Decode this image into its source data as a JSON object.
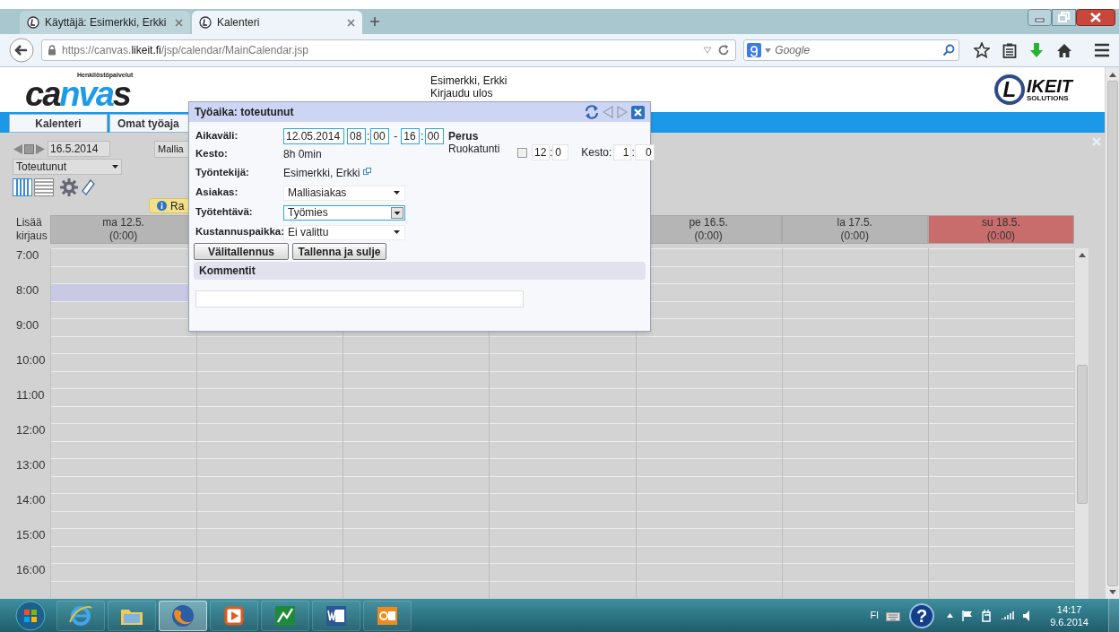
{
  "browser": {
    "tabs": [
      {
        "title": "Käyttäjä: Esimerkki, Erkki",
        "selected": false
      },
      {
        "title": "Kalenteri",
        "selected": true
      }
    ],
    "url": "https://canvas.**likeit.fi**/jsp/calendar/MainCalendar.jsp",
    "search": {
      "placeholder": "Google"
    }
  },
  "header": {
    "logo": {
      "tagline": "Henkilöstöpalvelut",
      "parts": [
        {
          "text": "ca",
          "color": "#222222"
        },
        {
          "text": "nva",
          "color": "#1e9be8"
        },
        {
          "text": "s",
          "color": "#222222"
        }
      ]
    },
    "user": "Esimerkki, Erkki",
    "logout": "Kirjaudu ulos",
    "brand": {
      "initial": "L",
      "word": "IKEIT",
      "subtitle": "SOLUTIONS"
    }
  },
  "nav": [
    {
      "label": "Kalenteri"
    },
    {
      "label": "Omat työaja"
    }
  ],
  "toolbar": {
    "date": "16.5.2014",
    "mode": "Toteutunut",
    "template_button": "Mallia",
    "info": "Ra",
    "views": [
      {
        "kind": "week",
        "selected": true
      },
      {
        "kind": "list",
        "selected": false
      }
    ]
  },
  "calendar": {
    "add_label": "Lisää kirjaus",
    "days": [
      {
        "label": "ma 12.5.",
        "total": "(0:00)",
        "holiday": false
      },
      {
        "label": "pe 16.5.",
        "total": "(0:00)",
        "holiday": false
      },
      {
        "label": "la 17.5.",
        "total": "(0:00)",
        "holiday": false
      },
      {
        "label": "su 18.5.",
        "total": "(0:00)",
        "holiday": true
      }
    ],
    "hours": [
      {
        "label": "7:00",
        "marked": false
      },
      {
        "label": "8:00",
        "marked": true
      },
      {
        "label": "9:00",
        "marked": false
      },
      {
        "label": "10:00",
        "marked": false
      },
      {
        "label": "11:00",
        "marked": false
      },
      {
        "label": "12:00",
        "marked": false
      },
      {
        "label": "13:00",
        "marked": false
      },
      {
        "label": "14:00",
        "marked": false
      },
      {
        "label": "15:00",
        "marked": false
      },
      {
        "label": "16:00",
        "marked": false
      }
    ]
  },
  "dialog": {
    "title": "Työaika: toteutunut",
    "range": {
      "label": "Aikaväli:",
      "date": "12.05.2014",
      "from": {
        "hours": "08",
        "sep": ":",
        "minutes": "00"
      },
      "dash": "-",
      "to": {
        "hours": "16",
        "sep": ":",
        "minutes": "00"
      }
    },
    "duration": {
      "label": "Kesto:",
      "value": "8h 0min"
    },
    "employee": {
      "label": "Työntekijä:",
      "value": "Esimerkki, Erkki"
    },
    "selects": [
      {
        "label": "Asiakas:",
        "value": "Malliasiakas",
        "focused": false
      },
      {
        "label": "Työtehtävä:",
        "value": "Työmies",
        "focused": true
      },
      {
        "label": "Kustannuspaikka:",
        "value": "Ei valittu",
        "focused": false
      }
    ],
    "lunch": {
      "heading": "Perus",
      "label": "Ruokatunti",
      "checked": false,
      "hours": "12",
      "sep": ":",
      "minutes": "0",
      "duration_label": "Kesto:",
      "duration_hours": "1",
      "duration_sep": ":",
      "duration_minutes": "0"
    },
    "buttons": [
      {
        "label": "Välitallennus"
      },
      {
        "label": "Tallenna ja sulje"
      }
    ],
    "comments_heading": "Kommentit"
  },
  "taskbar": {
    "apps": [
      {
        "kind": "ie",
        "active": false
      },
      {
        "kind": "folder",
        "active": false
      },
      {
        "kind": "firefox",
        "active": true
      },
      {
        "kind": "media",
        "active": false
      },
      {
        "kind": "chart",
        "active": false
      },
      {
        "kind": "word",
        "active": false
      },
      {
        "kind": "outlook",
        "active": false
      }
    ],
    "language": "FI",
    "help": "?",
    "time": "14:17",
    "date": "9.6.2014"
  }
}
